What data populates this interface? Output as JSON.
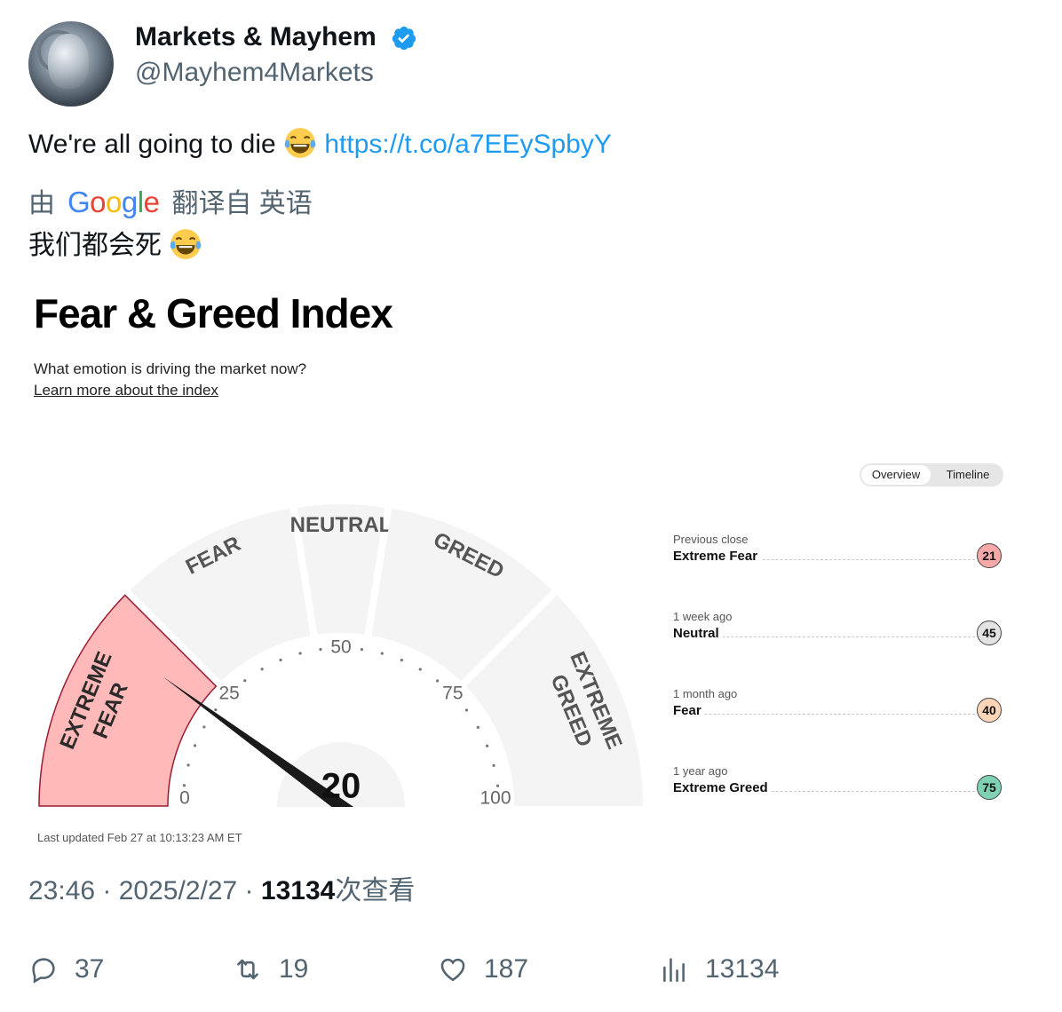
{
  "author": {
    "name": "Markets & Mayhem",
    "handle": "@Mayhem4Markets"
  },
  "tweet": {
    "text": "We're all going to die",
    "link": "https://t.co/a7EEySpbyY"
  },
  "translation": {
    "prefix": "由",
    "google_word": "Google",
    "suffix": "翻译自 英语",
    "text": "我们都会死"
  },
  "card": {
    "title": "Fear & Greed Index",
    "subtitle": "What emotion is driving the market now?",
    "learn_more": "Learn more about the index",
    "toggle": {
      "overview": "Overview",
      "timeline": "Timeline"
    },
    "last_updated": "Last updated Feb 27 at 10:13:23 AM ET"
  },
  "gauge": {
    "value": 20,
    "value_label": "20",
    "min": 0,
    "max": 100,
    "ticks": [
      "0",
      "25",
      "50",
      "75",
      "100"
    ],
    "segments": [
      {
        "line1": "EXTREME",
        "line2": "FEAR",
        "from": 0,
        "to": 25,
        "active": true,
        "color": "#ffb9b9"
      },
      {
        "line1": "FEAR",
        "line2": "",
        "from": 25,
        "to": 45,
        "active": false,
        "color": "#f4f4f4"
      },
      {
        "line1": "NEUTRAL",
        "line2": "",
        "from": 45,
        "to": 55,
        "active": false,
        "color": "#f4f4f4"
      },
      {
        "line1": "GREED",
        "line2": "",
        "from": 55,
        "to": 75,
        "active": false,
        "color": "#f4f4f4"
      },
      {
        "line1": "EXTREME",
        "line2": "GREED",
        "from": 75,
        "to": 100,
        "active": false,
        "color": "#f4f4f4"
      }
    ]
  },
  "history": [
    {
      "when": "Previous close",
      "rating": "Extreme Fear",
      "value": "21",
      "color": "#f9a8a8"
    },
    {
      "when": "1 week ago",
      "rating": "Neutral",
      "value": "45",
      "color": "#e3e3e3"
    },
    {
      "when": "1 month ago",
      "rating": "Fear",
      "value": "40",
      "color": "#fdd5b8"
    },
    {
      "when": "1 year ago",
      "rating": "Extreme Greed",
      "value": "75",
      "color": "#7fd1b3"
    }
  ],
  "meta": {
    "time": "23:46",
    "date": "2025/2/27",
    "views_count": "13134",
    "views_suffix": "次查看"
  },
  "actions": {
    "replies": "37",
    "reposts": "19",
    "likes": "187",
    "views": "13134"
  },
  "colors": {
    "link": "#1d9bf0",
    "muted": "#536471",
    "verified": "#1d9bf0"
  }
}
